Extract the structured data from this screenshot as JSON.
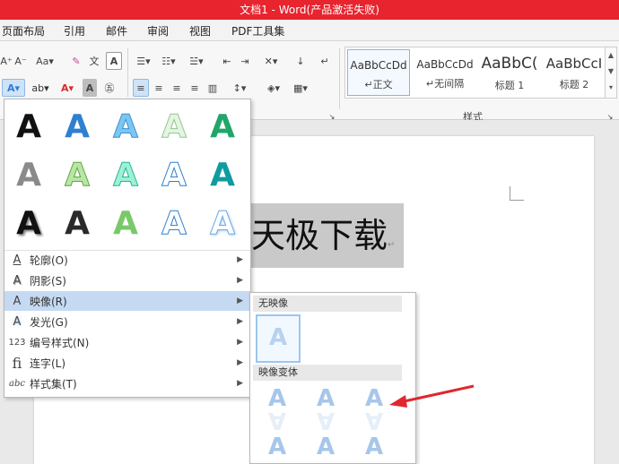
{
  "window": {
    "title": "文档1 - Word(产品激活失败)"
  },
  "tabs": [
    "页面布局",
    "引用",
    "邮件",
    "审阅",
    "视图",
    "PDF工具集"
  ],
  "styles": {
    "items": [
      {
        "sample": "AaBbCcDd",
        "name": "↵正文"
      },
      {
        "sample": "AaBbCcDd",
        "name": "↵无间隔"
      },
      {
        "sample": "AaBbC(",
        "name": "标题 1"
      },
      {
        "sample": "AaBbCcI",
        "name": "标题 2"
      }
    ],
    "group_label": "样式"
  },
  "document": {
    "selected_text": "天极下载"
  },
  "effects_menu": {
    "gallery_glyph": "A",
    "items": [
      {
        "icon": "A",
        "label": "轮廓(O)",
        "icon_name": "outline-icon"
      },
      {
        "icon": "A",
        "label": "阴影(S)",
        "icon_name": "shadow-icon"
      },
      {
        "icon": "A",
        "label": "映像(R)",
        "icon_name": "reflection-icon"
      },
      {
        "icon": "A",
        "label": "发光(G)",
        "icon_name": "glow-icon"
      },
      {
        "icon": "123",
        "label": "编号样式(N)",
        "icon_name": "number-style-icon"
      },
      {
        "icon": "fi",
        "label": "连字(L)",
        "icon_name": "ligature-icon"
      },
      {
        "icon": "abc",
        "label": "样式集(T)",
        "icon_name": "stylistic-set-icon"
      }
    ],
    "active_index": 2
  },
  "reflection_submenu": {
    "no_reflection_label": "无映像",
    "variants_label": "映像变体",
    "glyph": "A"
  },
  "colors": {
    "title_bar": "#e8242e",
    "accent_blue": "#2f7fd1",
    "arrow_red": "#e0272f"
  }
}
